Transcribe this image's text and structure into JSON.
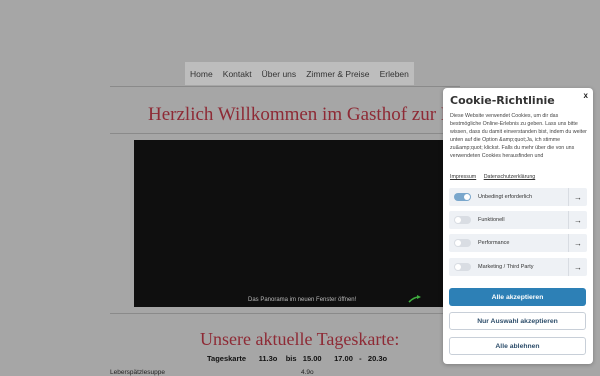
{
  "nav": {
    "items": [
      {
        "label": "Home"
      },
      {
        "label": "Kontakt"
      },
      {
        "label": "Über uns"
      },
      {
        "label": "Zimmer & Preise"
      },
      {
        "label": "Erleben"
      }
    ]
  },
  "welcome": {
    "title": "Herzlich Willkommen im Gasthof zur Pos"
  },
  "video": {
    "caption": "Das Panorama  im neuen Fenster öffnen!"
  },
  "menu": {
    "title": "Unsere aktuelle Tageskarte:",
    "line_label": "Tageskarte",
    "time1": "11.3o",
    "bis": "bis",
    "time2": "15.00",
    "time3": "17.00",
    "dash": "-",
    "time4": "20.3o",
    "bottom_left": "Leberspätzlesuppe",
    "bottom_value": "4.9o"
  },
  "cookie": {
    "close": "x",
    "title": "Cookie-Richtlinie",
    "text": "Diese Website verwendet Cookies, um dir das bestmögliche Online-Erlebnis zu geben. Lass uns bitte wissen, dass du damit einverstanden bist, indem du weiter unten auf die Option &amp;quot;Ja, ich stimme zu&amp;quot; klickst. Falls du mehr über die von uns verwendeten Cookies herausfinden und",
    "links": [
      {
        "label": "Impressum"
      },
      {
        "label": "Datenschutzerklärung"
      }
    ],
    "categories": [
      {
        "label": "Unbedingt erforderlich",
        "enabled": true
      },
      {
        "label": "Funktionell",
        "enabled": false
      },
      {
        "label": "Performance",
        "enabled": false
      },
      {
        "label": "Marketing / Third Party",
        "enabled": false
      }
    ],
    "accept_all": "Alle akzeptieren",
    "accept_selection": "Nur Auswahl akzeptieren",
    "reject_all": "Alle ablehnen",
    "colors": {
      "primary": "#2d80b6",
      "title_red": "#8e2a35",
      "toggle_on": "#7aa7cc"
    }
  }
}
